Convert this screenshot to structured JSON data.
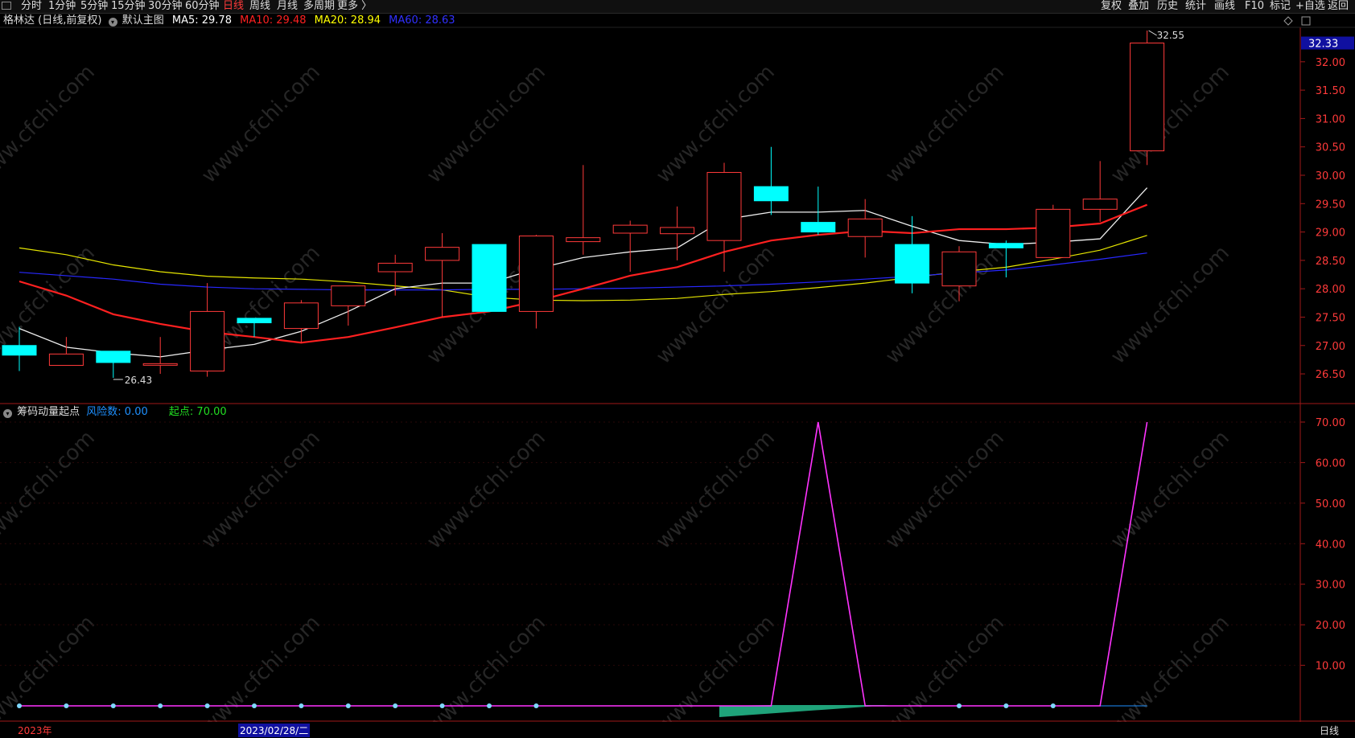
{
  "toolbar": {
    "periods": [
      "分时",
      "1分钟",
      "5分钟",
      "15分钟",
      "30分钟",
      "60分钟",
      "日线",
      "周线",
      "月线",
      "多周期",
      "更多 〉"
    ],
    "active_period": "日线",
    "right_items": [
      "复权",
      "叠加",
      "历史",
      "统计",
      "画线",
      "F10",
      "标记",
      "+自选",
      "返回"
    ]
  },
  "info": {
    "stock": "格林达 (日线,前复权)",
    "template": "默认主图",
    "ma5": "MA5: 29.78",
    "ma10": "MA10: 29.48",
    "ma20": "MA20: 28.94",
    "ma60": "MA60: 28.63",
    "colors": {
      "ma5": "#ffffff",
      "ma10": "#ff2020",
      "ma20": "#ffff00",
      "ma60": "#3030ff"
    }
  },
  "indicator": {
    "name": "筹码动量起点",
    "risk_label": "风险数: 0.00",
    "start_label": "起点: 70.00",
    "colors": {
      "risk": "#1e90ff",
      "start": "#22dd22",
      "line": "#ff33ff"
    }
  },
  "price_axis": {
    "current_price": "32.33",
    "ticks": [
      "32.00",
      "31.50",
      "31.00",
      "30.50",
      "30.00",
      "29.50",
      "29.00",
      "28.50",
      "28.00",
      "27.50",
      "27.00",
      "26.50"
    ],
    "high_label": "32.55",
    "low_label": "26.43"
  },
  "indicator_axis": {
    "ticks": [
      "70.00",
      "60.00",
      "50.00",
      "40.00",
      "30.00",
      "20.00",
      "10.00"
    ]
  },
  "bottom": {
    "year_label": "2023年",
    "cursor_date": "2023/02/28/二",
    "period_label": "日线"
  },
  "watermark": "www.cfchi.com",
  "chart_data": {
    "type": "candlestick",
    "candles": [
      {
        "o": 27.0,
        "h": 27.33,
        "l": 26.55,
        "c": 26.83
      },
      {
        "o": 26.65,
        "h": 27.15,
        "l": 26.65,
        "c": 26.85
      },
      {
        "o": 26.9,
        "h": 26.9,
        "l": 26.43,
        "c": 26.7
      },
      {
        "o": 26.68,
        "h": 27.15,
        "l": 26.5,
        "c": 26.68
      },
      {
        "o": 26.55,
        "h": 28.1,
        "l": 26.45,
        "c": 27.6
      },
      {
        "o": 27.48,
        "h": 27.48,
        "l": 27.15,
        "c": 27.4
      },
      {
        "o": 27.3,
        "h": 27.8,
        "l": 27.05,
        "c": 27.75
      },
      {
        "o": 27.7,
        "h": 28.05,
        "l": 27.35,
        "c": 28.05
      },
      {
        "o": 28.3,
        "h": 28.6,
        "l": 27.88,
        "c": 28.45
      },
      {
        "o": 28.5,
        "h": 28.98,
        "l": 27.5,
        "c": 28.73
      },
      {
        "o": 28.78,
        "h": 28.78,
        "l": 27.6,
        "c": 27.6
      },
      {
        "o": 27.6,
        "h": 28.95,
        "l": 27.3,
        "c": 28.93
      },
      {
        "o": 28.83,
        "h": 30.18,
        "l": 28.6,
        "c": 28.9
      },
      {
        "o": 28.98,
        "h": 29.2,
        "l": 28.3,
        "c": 29.12
      },
      {
        "o": 28.97,
        "h": 29.45,
        "l": 28.5,
        "c": 29.08
      },
      {
        "o": 28.85,
        "h": 30.22,
        "l": 28.3,
        "c": 30.05
      },
      {
        "o": 29.8,
        "h": 30.5,
        "l": 29.3,
        "c": 29.55
      },
      {
        "o": 29.17,
        "h": 29.8,
        "l": 28.95,
        "c": 29.0
      },
      {
        "o": 28.92,
        "h": 29.58,
        "l": 28.55,
        "c": 29.23
      },
      {
        "o": 28.78,
        "h": 29.28,
        "l": 27.92,
        "c": 28.1
      },
      {
        "o": 28.05,
        "h": 28.75,
        "l": 27.78,
        "c": 28.65
      },
      {
        "o": 28.8,
        "h": 28.85,
        "l": 28.2,
        "c": 28.72
      },
      {
        "o": 28.55,
        "h": 29.48,
        "l": 28.55,
        "c": 29.4
      },
      {
        "o": 29.4,
        "h": 30.25,
        "l": 29.18,
        "c": 29.58
      },
      {
        "o": 30.43,
        "h": 32.55,
        "l": 30.18,
        "c": 32.33
      }
    ],
    "ma5": [
      27.3,
      26.97,
      26.87,
      26.8,
      26.92,
      27.02,
      27.25,
      27.6,
      28.0,
      28.1,
      28.1,
      28.35,
      28.55,
      28.65,
      28.72,
      29.22,
      29.35,
      29.35,
      29.38,
      29.1,
      28.85,
      28.78,
      28.82,
      28.88,
      29.78
    ],
    "ma10": [
      28.13,
      27.88,
      27.55,
      27.38,
      27.24,
      27.15,
      27.05,
      27.15,
      27.32,
      27.5,
      27.6,
      27.78,
      28.0,
      28.23,
      28.38,
      28.65,
      28.85,
      28.95,
      29.02,
      28.98,
      29.05,
      29.05,
      29.08,
      29.15,
      29.48
    ],
    "ma20": [
      28.72,
      28.6,
      28.42,
      28.3,
      28.22,
      28.19,
      28.17,
      28.12,
      28.05,
      27.98,
      27.85,
      27.8,
      27.79,
      27.8,
      27.83,
      27.9,
      27.95,
      28.02,
      28.1,
      28.2,
      28.3,
      28.38,
      28.52,
      28.68,
      28.94
    ],
    "ma60": [
      28.29,
      28.23,
      28.17,
      28.08,
      28.03,
      28.0,
      27.99,
      27.98,
      27.98,
      27.98,
      27.99,
      27.99,
      28.0,
      28.01,
      28.03,
      28.05,
      28.08,
      28.12,
      28.17,
      28.22,
      28.28,
      28.33,
      28.42,
      28.52,
      28.63
    ],
    "indicator_start": [
      0,
      0,
      0,
      0,
      0,
      0,
      0,
      0,
      0,
      0,
      0,
      0,
      0,
      0,
      0,
      0,
      0,
      70,
      0,
      0,
      0,
      0,
      0,
      0,
      70
    ],
    "indicator_ylim": [
      0,
      70
    ],
    "price_ylim": [
      26.2,
      32.62
    ]
  }
}
